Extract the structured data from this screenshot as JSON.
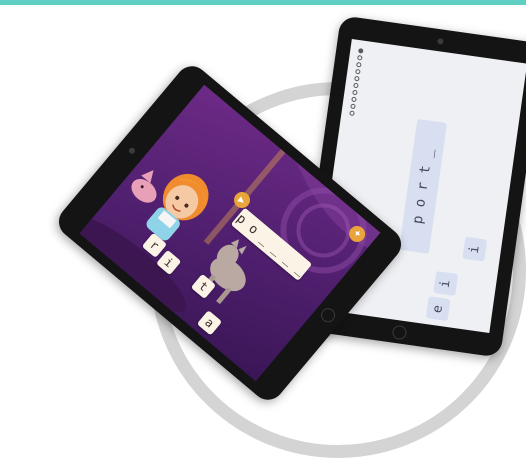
{
  "back_tablet": {
    "progress_dots_total": 10,
    "progress_dots_filled": 1,
    "word": "p o r t _",
    "letters": [
      "i",
      "i",
      "e"
    ]
  },
  "front_tablet": {
    "word": "p o _ _ _ _",
    "letters": [
      "r",
      "i",
      "t",
      "a"
    ],
    "icons": [
      "audio-icon",
      "gear-icon"
    ]
  },
  "colors": {
    "accent_bar": "#5fcfc4",
    "ring": "#d4d4d4",
    "front_screen_bg": "#5a2278",
    "tile_bg": "#fbf4e6",
    "back_tile_bg": "#d7dff0",
    "button_orange": "#e9a43a"
  }
}
